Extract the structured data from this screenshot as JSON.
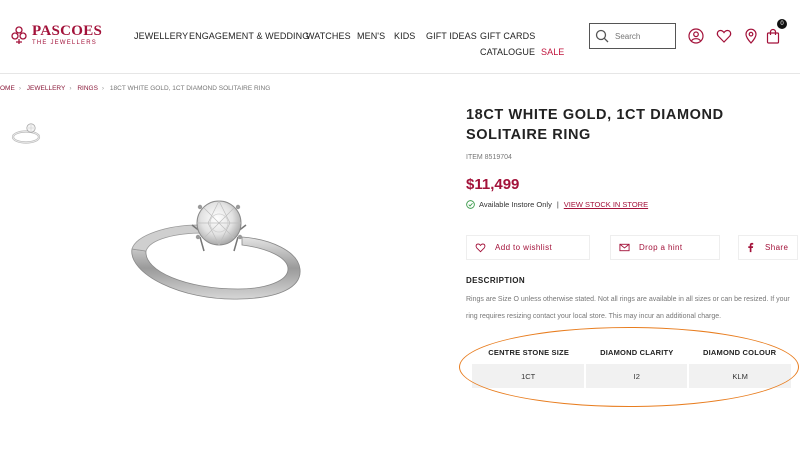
{
  "brand": {
    "name": "PASCOES",
    "tagline": "THE JEWELLERS",
    "color": "#a3123a"
  },
  "nav": [
    "JEWELLERY",
    "ENGAGEMENT & WEDDING",
    "WATCHES",
    "MEN'S",
    "KIDS",
    "GIFT IDEAS",
    "GIFT CARDS",
    "CATALOGUE",
    "SALE"
  ],
  "search": {
    "placeholder": "Search"
  },
  "header_icons": [
    "user-icon",
    "heart-icon",
    "location-icon",
    "bag-icon"
  ],
  "cart": {
    "count": "0"
  },
  "breadcrumb": [
    "OME",
    "JEWELLERY",
    "RINGS",
    "18CT WHITE GOLD, 1CT DIAMOND SOLITAIRE RING"
  ],
  "product": {
    "title": "18CT WHITE GOLD, 1CT DIAMOND SOLITAIRE RING",
    "item": "ITEM 8519704",
    "price": "$11,499",
    "availability": "Available Instore Only",
    "availability_separator": "|",
    "stock_link": "VIEW STOCK IN STORE"
  },
  "actions": {
    "wishlist": "Add to wishlist",
    "hint": "Drop a hint",
    "share": "Share"
  },
  "description": {
    "heading": "DESCRIPTION",
    "text": "Rings are Size O unless otherwise stated. Not all rings are available in all sizes or can be resized. If your ring requires resizing contact your local store. This may incur an additional charge."
  },
  "specs": {
    "headers": [
      "CENTRE STONE SIZE",
      "DIAMOND CLARITY",
      "DIAMOND COLOUR"
    ],
    "values": [
      "1CT",
      "I2",
      "KLM"
    ]
  },
  "annotation_color": "#e87d1f"
}
